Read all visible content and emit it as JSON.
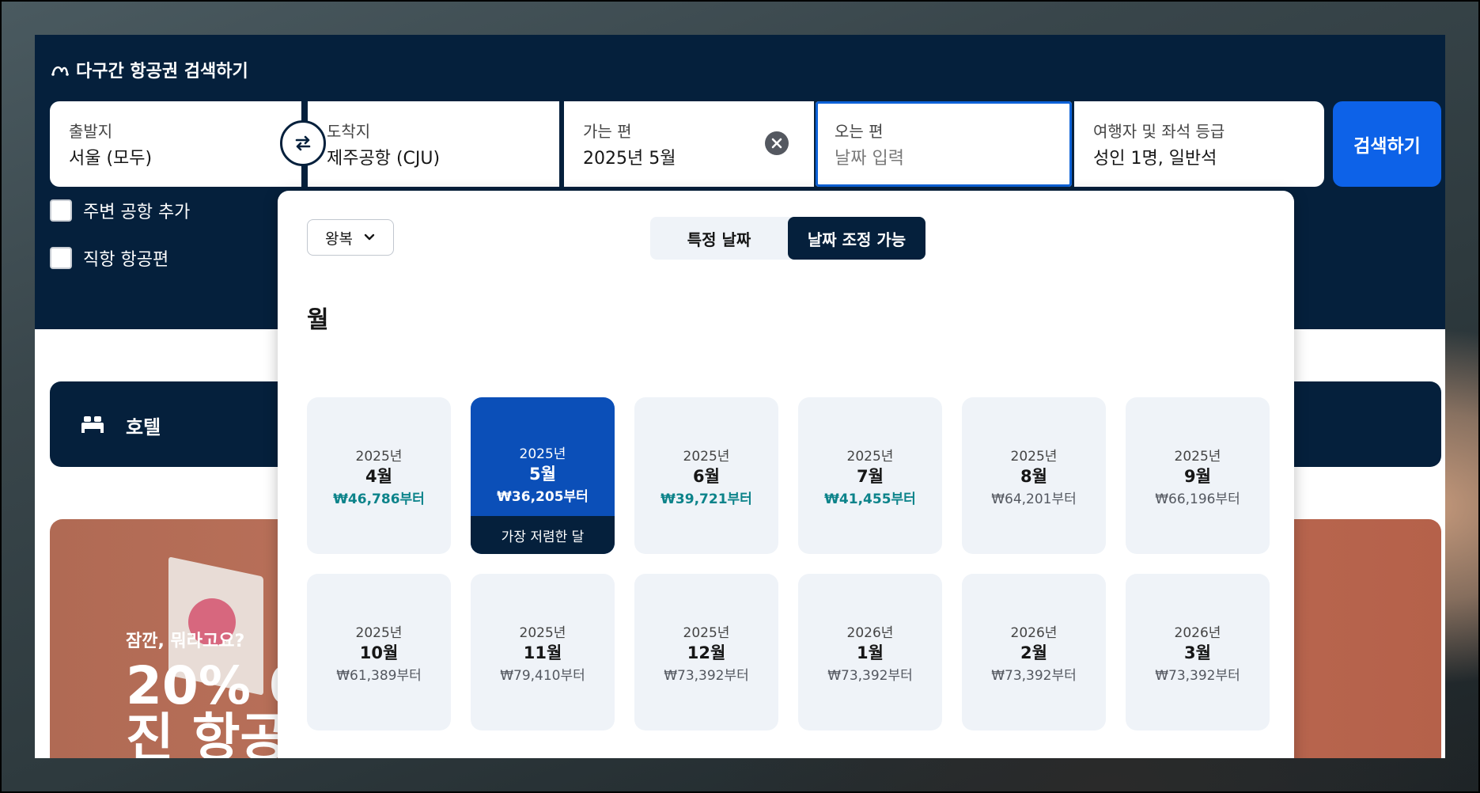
{
  "header": {
    "title": "다구간 항공권 검색하기"
  },
  "search": {
    "origin": {
      "label": "출발지",
      "value": "서울 (모두)"
    },
    "destination": {
      "label": "도착지",
      "value": "제주공항 (CJU)"
    },
    "depart": {
      "label": "가는 편",
      "value": "2025년 5월"
    },
    "return": {
      "label": "오는 편",
      "placeholder": "날짜 입력"
    },
    "passengers": {
      "label": "여행자 및 좌석 등급",
      "value": "성인 1명, 일반석"
    },
    "search_button": "검색하기"
  },
  "options": {
    "nearby_airports": "주변 공항 추가",
    "direct_flights": "직항 항공편"
  },
  "hotel_bar": {
    "label": "호텔"
  },
  "promo": {
    "small": "잠깐, 뭐라고요?",
    "big": "20% 0\n진 항공"
  },
  "picker": {
    "trip_type": "왕복",
    "tabs": [
      "특정 날짜",
      "날짜 조정 가능"
    ],
    "active_tab": "날짜 조정 가능",
    "heading": "월",
    "cheapest_badge": "가장 저렴한 달",
    "months": [
      {
        "year": "2025년",
        "month": "4월",
        "price": "₩46,786부터",
        "highlight": true,
        "selected": false
      },
      {
        "year": "2025년",
        "month": "5월",
        "price": "₩36,205부터",
        "highlight": true,
        "selected": true
      },
      {
        "year": "2025년",
        "month": "6월",
        "price": "₩39,721부터",
        "highlight": true,
        "selected": false
      },
      {
        "year": "2025년",
        "month": "7월",
        "price": "₩41,455부터",
        "highlight": true,
        "selected": false
      },
      {
        "year": "2025년",
        "month": "8월",
        "price": "₩64,201부터",
        "highlight": false,
        "selected": false
      },
      {
        "year": "2025년",
        "month": "9월",
        "price": "₩66,196부터",
        "highlight": false,
        "selected": false
      },
      {
        "year": "2025년",
        "month": "10월",
        "price": "₩61,389부터",
        "highlight": false,
        "selected": false
      },
      {
        "year": "2025년",
        "month": "11월",
        "price": "₩79,410부터",
        "highlight": false,
        "selected": false
      },
      {
        "year": "2025년",
        "month": "12월",
        "price": "₩73,392부터",
        "highlight": false,
        "selected": false
      },
      {
        "year": "2026년",
        "month": "1월",
        "price": "₩73,392부터",
        "highlight": false,
        "selected": false
      },
      {
        "year": "2026년",
        "month": "2월",
        "price": "₩73,392부터",
        "highlight": false,
        "selected": false
      },
      {
        "year": "2026년",
        "month": "3월",
        "price": "₩73,392부터",
        "highlight": false,
        "selected": false
      }
    ]
  },
  "colors": {
    "navy": "#05203c",
    "accent_blue": "#0d62e8",
    "selected_card": "#0b4fb8",
    "price_green": "#0c838a",
    "card_bg": "#eff3f8"
  }
}
